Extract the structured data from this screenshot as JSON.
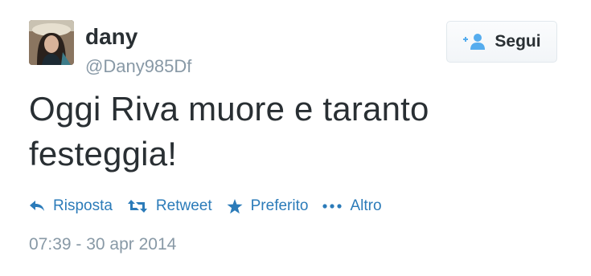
{
  "user": {
    "display_name": "dany",
    "username": "@Dany985Df",
    "avatar_icon": "user-photo"
  },
  "follow": {
    "label": "Segui",
    "icon": "add-user-icon"
  },
  "tweet": {
    "text": "Oggi Riva muore e taranto festeggia!"
  },
  "actions": [
    {
      "label": "Risposta",
      "icon": "reply-icon"
    },
    {
      "label": "Retweet",
      "icon": "retweet-icon"
    },
    {
      "label": "Preferito",
      "icon": "star-icon"
    },
    {
      "label": "Altro",
      "icon": "more-icon"
    }
  ],
  "timestamp": "07:39 - 30 apr 2014",
  "colors": {
    "text": "#292f33",
    "muted": "#8899a6",
    "link": "#2b7bb9"
  }
}
